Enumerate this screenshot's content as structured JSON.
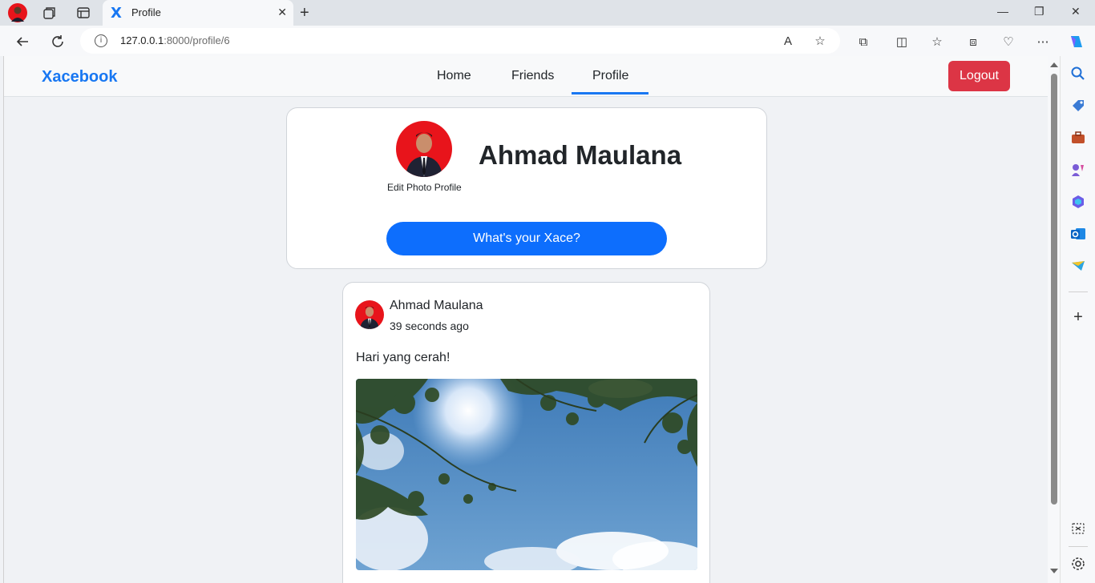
{
  "browser": {
    "tab_title": "Profile",
    "tab_icon_letter": "X",
    "url_host": "127.0.0.1",
    "url_path": ":8000/profile/6"
  },
  "navbar": {
    "brand": "Xacebook",
    "links": [
      "Home",
      "Friends",
      "Profile"
    ],
    "active_link": "Profile",
    "logout_label": "Logout"
  },
  "profile": {
    "name": "Ahmad Maulana",
    "edit_photo_label": "Edit Photo Profile",
    "compose_label": "What's your Xace?"
  },
  "post": {
    "author": "Ahmad Maulana",
    "time": "39 seconds ago",
    "text": "Hari yang cerah!"
  },
  "colors": {
    "brand": "#1877f2",
    "logout": "#dc3545",
    "compose": "#0d6efd",
    "avatar_bg": "#e8141b"
  }
}
